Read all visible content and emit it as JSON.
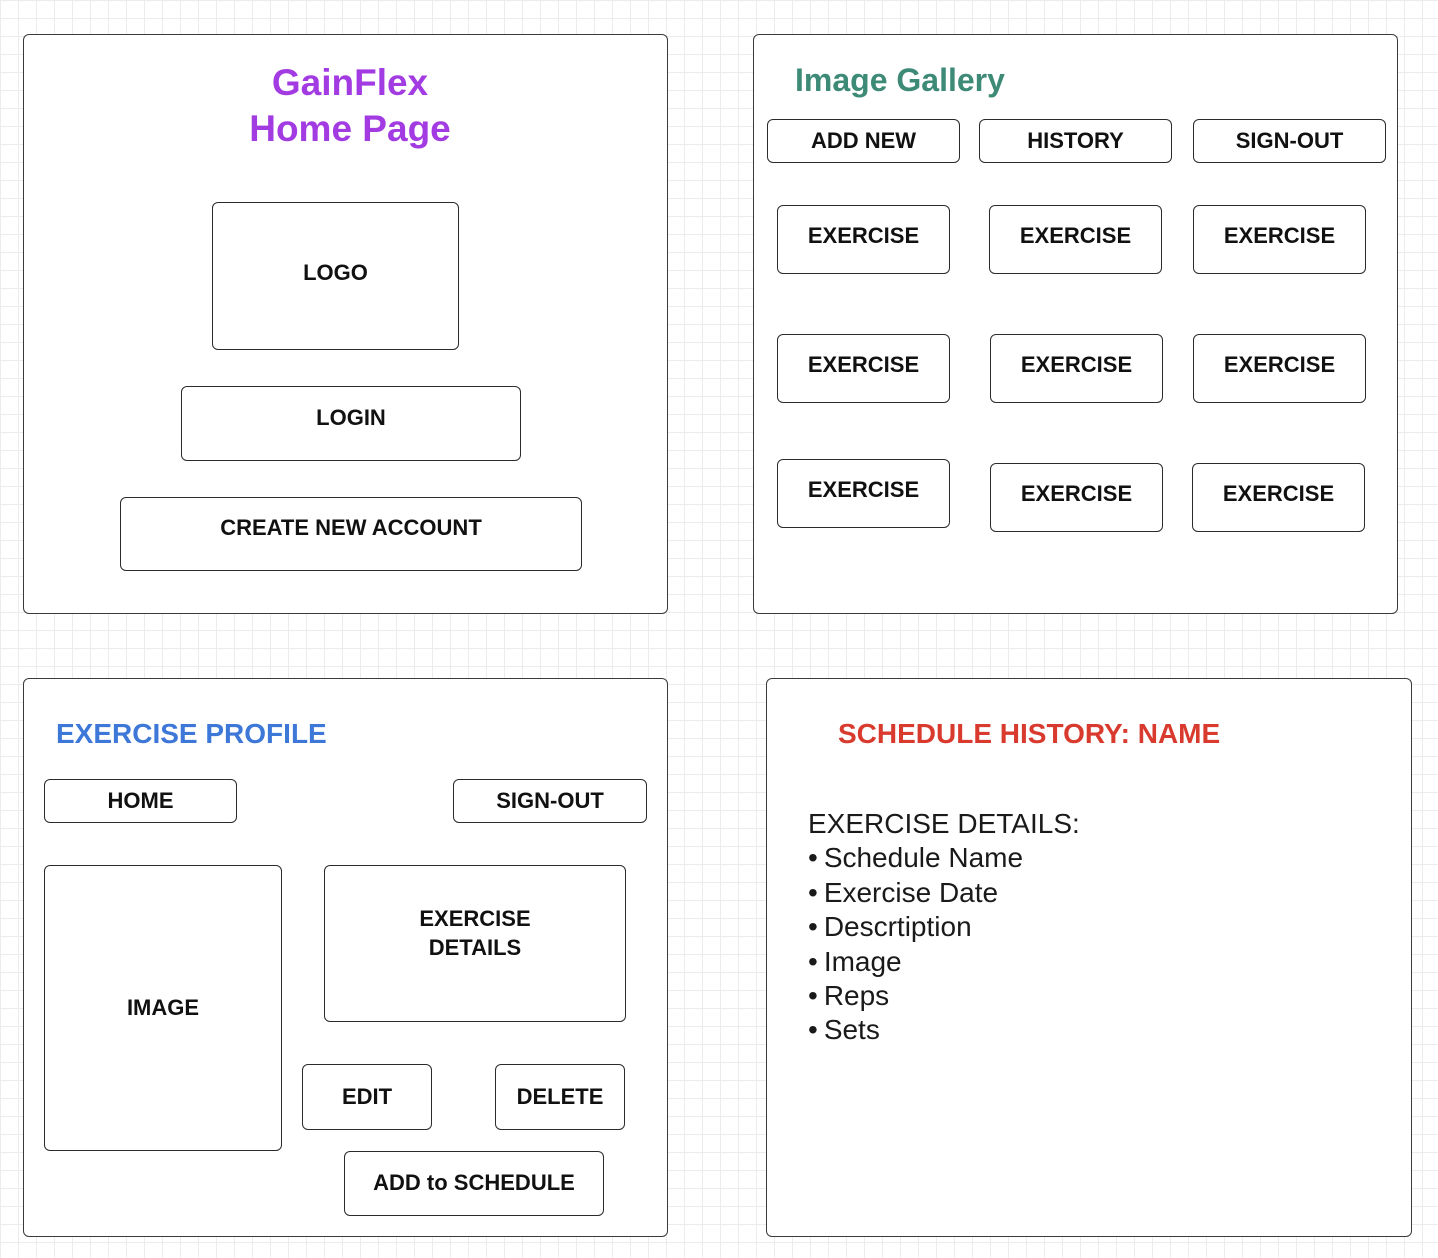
{
  "colors": {
    "home_title": "#a33be3",
    "gallery_title": "#3d8a76",
    "profile_title": "#3d78d8",
    "history_title": "#d93a2e",
    "border": "#2b2b2b"
  },
  "home_page": {
    "title_line1": "GainFlex",
    "title_line2": "Home Page",
    "logo": "LOGO",
    "login": "LOGIN",
    "create_account": "CREATE NEW ACCOUNT"
  },
  "image_gallery": {
    "title": "Image Gallery",
    "nav": [
      "ADD NEW",
      "HISTORY",
      "SIGN-OUT"
    ],
    "exercises": [
      "EXERCISE",
      "EXERCISE",
      "EXERCISE",
      "EXERCISE",
      "EXERCISE",
      "EXERCISE",
      "EXERCISE",
      "EXERCISE",
      "EXERCISE"
    ]
  },
  "exercise_profile": {
    "title": "EXERCISE PROFILE",
    "home": "HOME",
    "sign_out": "SIGN-OUT",
    "image": "IMAGE",
    "details_line1": "EXERCISE",
    "details_line2": "DETAILS",
    "edit": "EDIT",
    "delete": "DELETE",
    "add_to_schedule": "ADD to SCHEDULE"
  },
  "schedule_history": {
    "title": "SCHEDULE HISTORY: NAME",
    "details_heading": "EXERCISE DETAILS:",
    "items": [
      "Schedule Name",
      "Exercise Date",
      "Descrtiption",
      "Image",
      "Reps",
      "Sets"
    ]
  }
}
